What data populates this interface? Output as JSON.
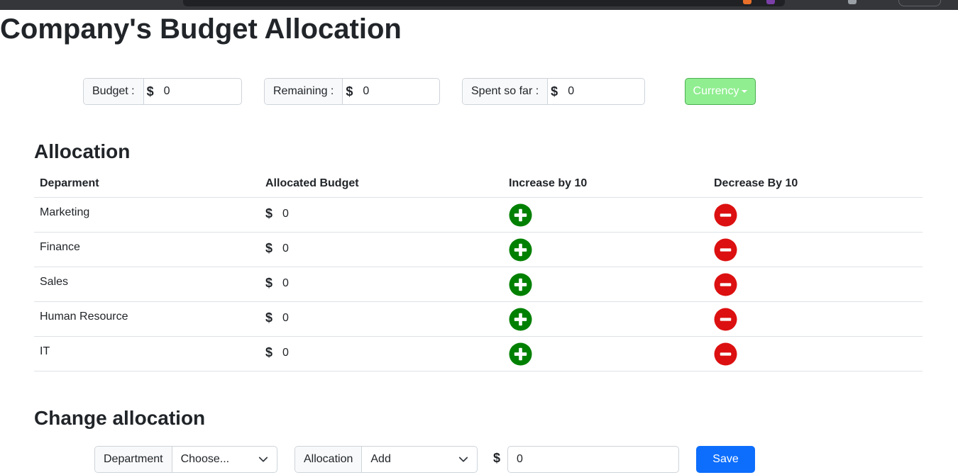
{
  "page": {
    "title": "Company's Budget Allocation"
  },
  "summary": {
    "budget": {
      "label": "Budget :",
      "currency_symbol": "$",
      "value": "0"
    },
    "remaining": {
      "label": "Remaining :",
      "currency_symbol": "$",
      "value": "0"
    },
    "spent": {
      "label": "Spent so far :",
      "currency_symbol": "$",
      "value": "0"
    },
    "currency_button": {
      "label": "Currency",
      "color": "#90ee90"
    }
  },
  "allocation": {
    "title": "Allocation",
    "columns": [
      "Deparment",
      "Allocated Budget",
      "Increase by 10",
      "Decrease By 10"
    ],
    "rows": [
      {
        "department": "Marketing",
        "currency_symbol": "$",
        "budget": "0"
      },
      {
        "department": "Finance",
        "currency_symbol": "$",
        "budget": "0"
      },
      {
        "department": "Sales",
        "currency_symbol": "$",
        "budget": "0"
      },
      {
        "department": "Human Resource",
        "currency_symbol": "$",
        "budget": "0"
      },
      {
        "department": "IT",
        "currency_symbol": "$",
        "budget": "0"
      }
    ],
    "increase_icon": "plus-circle-icon",
    "decrease_icon": "minus-circle-icon",
    "increase_color": "#008000",
    "decrease_color": "#dc1010"
  },
  "change_allocation": {
    "title": "Change allocation",
    "department_label": "Department",
    "department_selected": "Choose...",
    "allocation_label": "Allocation",
    "allocation_selected": "Add",
    "currency_symbol": "$",
    "amount_value": "0",
    "save_label": "Save",
    "save_color": "#0d6efd"
  }
}
